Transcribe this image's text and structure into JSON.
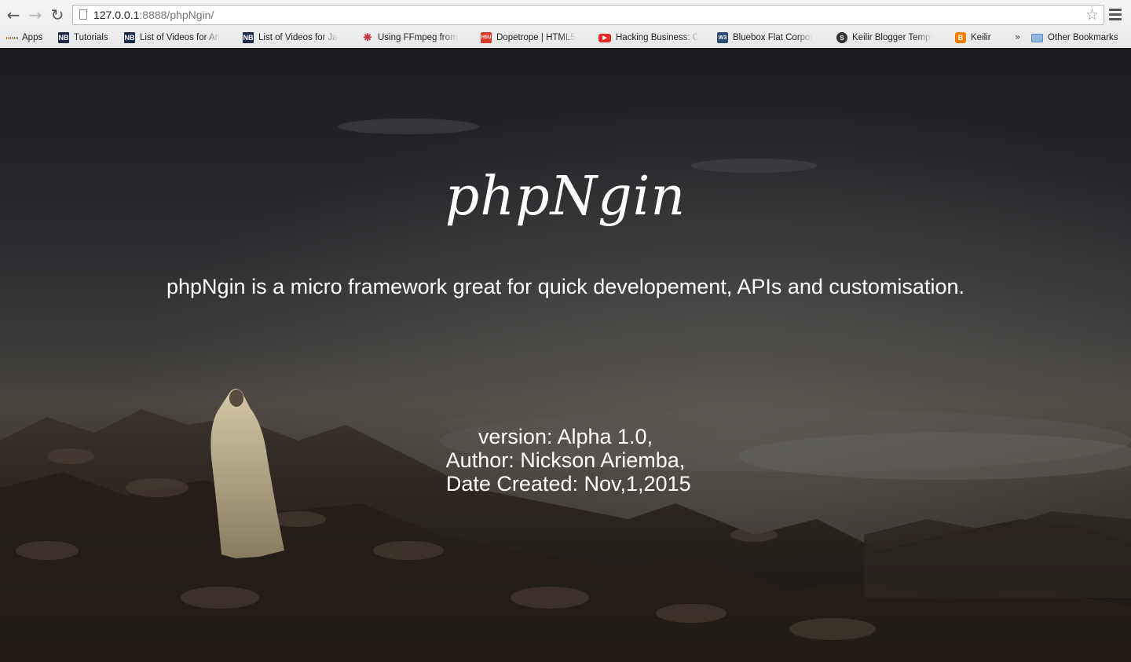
{
  "browser": {
    "url_host": "127.0.0.1",
    "url_rest": ":8888/phpNgin/",
    "bookmarks": [
      {
        "label": "Apps",
        "icon": "apps-grid-icon"
      },
      {
        "label": "Tutorials",
        "icon": "nb-icon"
      },
      {
        "label": "List of Videos for An",
        "icon": "nb-icon"
      },
      {
        "label": "List of Videos for Ja",
        "icon": "nb-icon"
      },
      {
        "label": "Using FFmpeg from",
        "icon": "ffmpeg-icon"
      },
      {
        "label": "Dopetrope | HTML5",
        "icon": "hsu-icon"
      },
      {
        "label": "Hacking Business: C",
        "icon": "youtube-icon"
      },
      {
        "label": "Bluebox Flat Corpor",
        "icon": "w3-icon"
      },
      {
        "label": "Keilir Blogger Templ",
        "icon": "s-icon"
      },
      {
        "label": "Keilir",
        "icon": "blogger-icon"
      },
      {
        "label": "Other Bookmarks",
        "icon": "folder-icon"
      }
    ],
    "overflow_label": "»"
  },
  "page": {
    "logo_text": "phpNgin",
    "tagline": "phpNgin is a micro framework great for quick developement, APIs and customisation.",
    "meta": {
      "version": "version: Alpha 1.0,",
      "author": "Author: Nickson Ariemba,",
      "date": " Date Created: Nov,1,2015"
    }
  },
  "colors": {
    "text": "#ffffff",
    "chrome_bg": "#ececec",
    "apps_dots": [
      "#e94235",
      "#fbbc05",
      "#34a853",
      "#4285f4",
      "#e94235",
      "#fbbc05",
      "#34a853",
      "#4285f4",
      "#e94235"
    ]
  }
}
